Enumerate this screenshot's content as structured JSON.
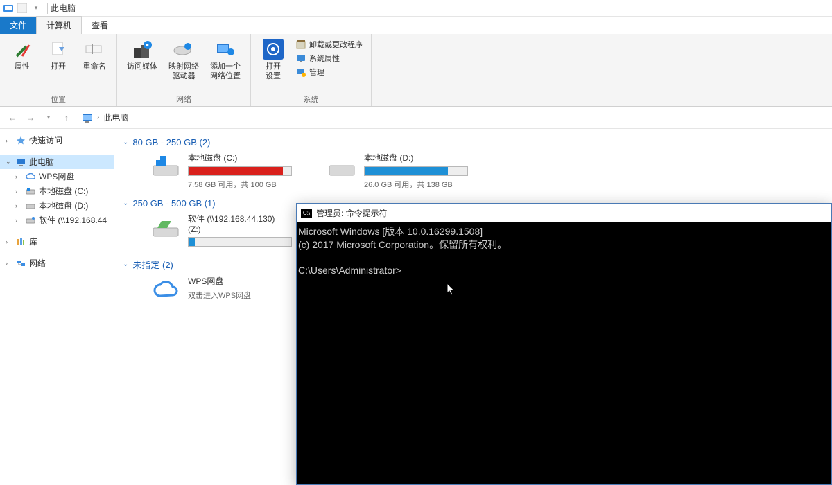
{
  "titlebar": {
    "title": "此电脑"
  },
  "tabs": {
    "file": "文件",
    "computer": "计算机",
    "view": "查看"
  },
  "ribbon": {
    "group_location": {
      "label": "位置",
      "properties": "属性",
      "open": "打开",
      "rename": "重命名"
    },
    "group_network": {
      "label": "网络",
      "access_media": "访问媒体",
      "map_drive": "映射网络\n驱动器",
      "add_loc": "添加一个\n网络位置"
    },
    "group_system": {
      "label": "系统",
      "open_settings": "打开\n设置",
      "uninstall": "卸载或更改程序",
      "sysprops": "系统属性",
      "manage": "管理"
    }
  },
  "breadcrumb": {
    "root": "此电脑"
  },
  "sidebar": {
    "quick": "快速访问",
    "thispc": "此电脑",
    "wps": "WPS网盘",
    "c": "本地磁盘 (C:)",
    "d": "本地磁盘 (D:)",
    "z": "软件 (\\\\192.168.44",
    "lib": "库",
    "net": "网络"
  },
  "groups": {
    "g1_title": "80 GB - 250 GB (2)",
    "g2_title": "250 GB - 500 GB (1)",
    "g3_title": "未指定 (2)"
  },
  "drives": {
    "c": {
      "name": "本地磁盘 (C:)",
      "sub": "7.58 GB 可用，共 100 GB",
      "fill": 92,
      "color": "#d9201c"
    },
    "d": {
      "name": "本地磁盘 (D:)",
      "sub": "26.0 GB 可用，共 138 GB",
      "fill": 81,
      "color": "#1e90d6"
    },
    "z": {
      "name": "软件 (\\\\192.168.44.130)\n(Z:)",
      "sub": "",
      "fill": 6,
      "color": "#1e90d6"
    },
    "wps": {
      "name": "WPS网盘",
      "sub": "双击进入WPS网盘"
    }
  },
  "cmd": {
    "title": "管理员: 命令提示符",
    "line1": "Microsoft Windows [版本 10.0.16299.1508]",
    "line2": "(c) 2017 Microsoft Corporation。保留所有权利。",
    "prompt": "C:\\Users\\Administrator>"
  }
}
